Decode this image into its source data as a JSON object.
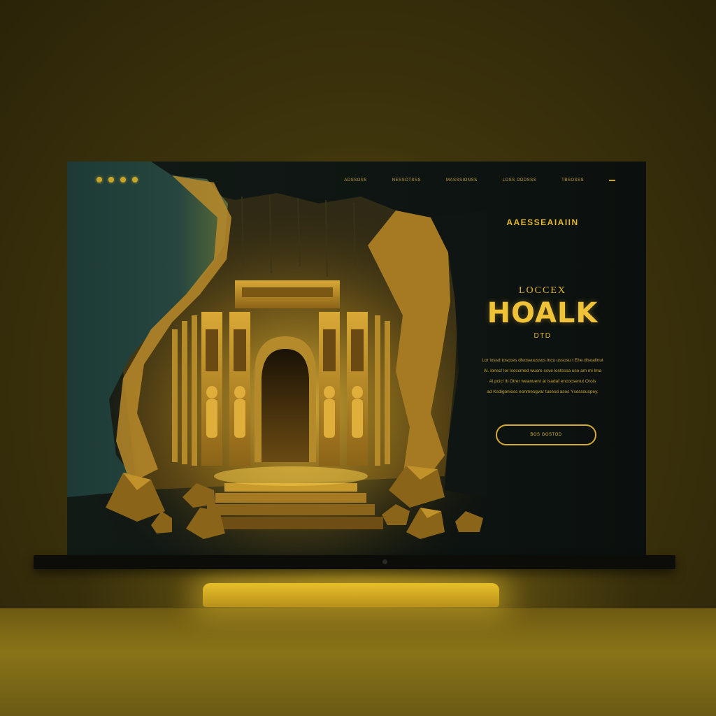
{
  "nav": {
    "items": [
      "ADSSOSS",
      "NESSOTSSS",
      "MASSSIONSS",
      "LOSS ODDSSS",
      "TBSOSSS"
    ]
  },
  "hero": {
    "eyebrow": "AAESSEAIAIIN",
    "subtitle_top": "LOCCEX",
    "title": "HOALK",
    "subtitle_bottom": "DTD",
    "body_lines": [
      "Lor lossd toscces dlvosvuussos lncu ussosu t Ehe disoalinut",
      "Ai. lonsc! lor lsoccmed wusre ssve lostsssa uso am mi lma",
      "Ai pcic! iti Otrer weanuent at isadaf encocsenut Orois",
      "ad Ksdigonioss eonmesgvar tusesd asos Ysosssuspey."
    ],
    "cta_label": "Bos GOSTOD"
  },
  "colors": {
    "accent": "#e3b62f",
    "screen_bg": "#0e1512",
    "backdrop": "#3e340c"
  }
}
